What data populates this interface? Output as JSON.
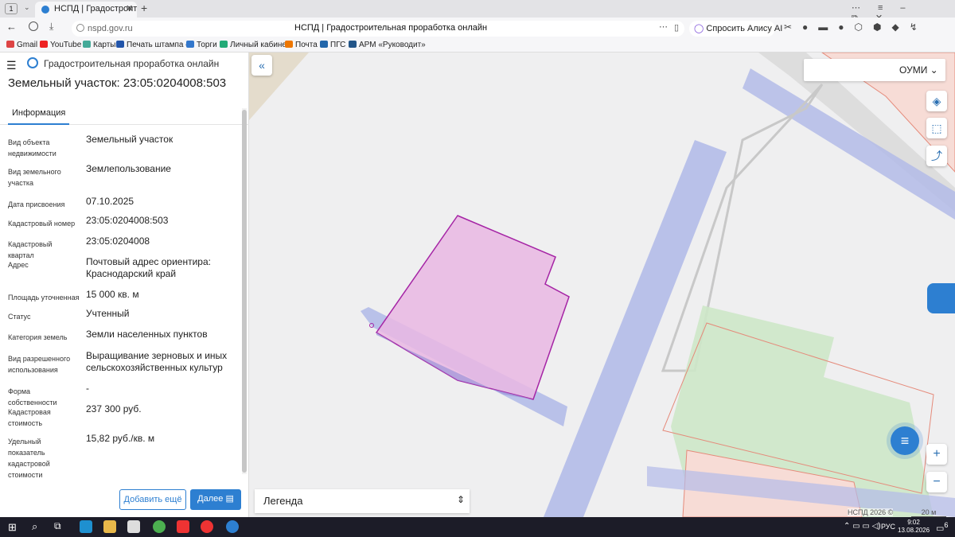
{
  "browser": {
    "tab_count": "1",
    "tab_title": "НСПД | Градостроитель",
    "url": "nspd.gov.ru",
    "page_title": "НСПД | Градостроительная проработка онлайн",
    "alice_label": "Спросить Алису AI"
  },
  "bookmarks": [
    "Gmail",
    "YouTube",
    "Карты",
    "Печать штампа с",
    "Торги",
    "Личный кабинет",
    "Почта",
    "ПГС",
    "АРМ «Руководит»"
  ],
  "bookmark_colors": [
    "#d44",
    "#e22",
    "#4a9",
    "#25a",
    "#37c",
    "#2a7",
    "#e70",
    "#26a",
    "#258"
  ],
  "panel": {
    "app_title": "Градостроительная проработка онлайн",
    "heading": "Земельный участок: 23:05:0204008:503",
    "tab_info": "Информация",
    "fields": [
      {
        "label": "Вид объекта недвижимости",
        "value": "Земельный участок"
      },
      {
        "label": "Вид земельного участка",
        "value": "Землепользование"
      },
      {
        "label": "Дата присвоения",
        "value": "07.10.2025"
      },
      {
        "label": "Кадастровый номер",
        "value": "23:05:0204008:503"
      },
      {
        "label": "Кадастровый квартал",
        "value": "23:05:0204008"
      },
      {
        "label": "Адрес",
        "value": "Почтовый адрес ориентира: Краснодарский край"
      },
      {
        "label": "Площадь уточненная",
        "value": "15 000 кв. м"
      },
      {
        "label": "Статус",
        "value": "Учтенный"
      },
      {
        "label": "Категория земель",
        "value": "Земли населенных пунктов"
      },
      {
        "label": "Вид разрешенного использования",
        "value": "Выращивание зерновых и иных сельскохозяйственных культур"
      },
      {
        "label": "Форма собственности",
        "value": "-"
      },
      {
        "label": "Кадастровая стоимость",
        "value": "237 300 руб."
      },
      {
        "label": "Удельный показатель кадастровой стоимости",
        "value": "15,82 руб./кв. м"
      }
    ],
    "add_more": "Добавить ещё",
    "next": "Далее"
  },
  "map": {
    "layer_select": "ОУМИ",
    "legend": "Легенда",
    "attribution": "НСПД 2026 ©",
    "scale": "20 м",
    "zoom_in": "+",
    "zoom_out": "−"
  },
  "taskbar": {
    "lang": "РУС",
    "time": "9:02",
    "date": "13.08.2026",
    "notif_count": "6"
  }
}
